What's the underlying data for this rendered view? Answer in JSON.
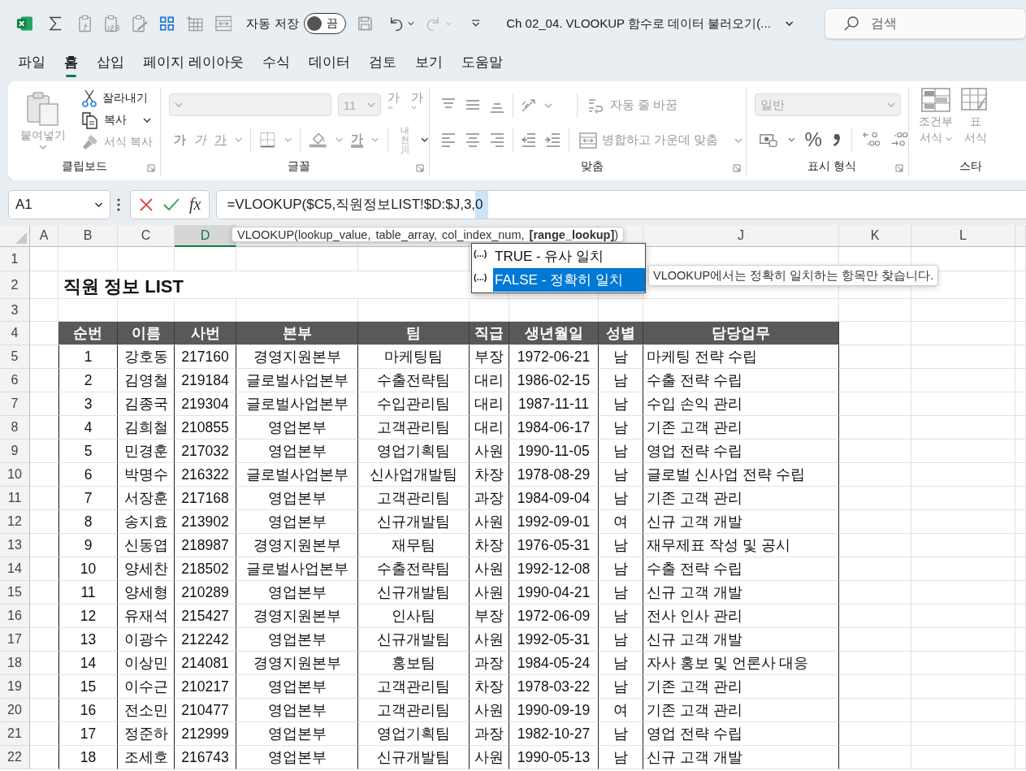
{
  "quick_access": {
    "autosave_label": "자동 저장",
    "autosave": {
      "on": false,
      "label": "끔"
    }
  },
  "title": "Ch 02_04. VLOOKUP 함수로 데이터 불러오기(...",
  "search": {
    "placeholder": "검색"
  },
  "tabs": [
    {
      "label": "파일",
      "selected": false
    },
    {
      "label": "홈",
      "selected": true
    },
    {
      "label": "삽입",
      "selected": false
    },
    {
      "label": "페이지 레이아웃",
      "selected": false
    },
    {
      "label": "수식",
      "selected": false
    },
    {
      "label": "데이터",
      "selected": false
    },
    {
      "label": "검토",
      "selected": false
    },
    {
      "label": "보기",
      "selected": false
    },
    {
      "label": "도움말",
      "selected": false
    }
  ],
  "ribbon": {
    "clipboard": {
      "label": "클립보드",
      "paste": {
        "label": "붙여넣기",
        "disabled": true
      },
      "cut": {
        "label": "잘라내기",
        "disabled": false
      },
      "copy": {
        "label": "복사",
        "disabled": false
      },
      "format_painter": {
        "label": "서식 복사",
        "disabled": true
      }
    },
    "font": {
      "label": "글꼴",
      "size": "11",
      "grow": "가",
      "shrink": "가",
      "bold": "가",
      "italic": "가",
      "underline": "가",
      "font_color": "가",
      "phonetic": [
        "내천",
        "川"
      ]
    },
    "alignment": {
      "label": "맞춤",
      "wrap": {
        "label": "자동 줄 바꿈",
        "disabled": true
      },
      "merge": {
        "label": "병합하고 가운데 맞춤",
        "disabled": true
      }
    },
    "number": {
      "label": "표시 형식",
      "format": "일반",
      "percent": "%"
    },
    "styles": {
      "label": "스타",
      "conditional": {
        "lines": [
          "조건부",
          "서식"
        ],
        "disabled": true
      },
      "table": {
        "lines": [
          "표",
          "서식"
        ],
        "disabled": true
      }
    }
  },
  "formula_bar": {
    "name_box": "A1",
    "insert_function": "fx",
    "formula": "=VLOOKUP($C5,직원정보LIST!$D:$J,3,",
    "formula_selection": "0"
  },
  "column_headers": [
    {
      "label": "A",
      "selected": false
    },
    {
      "label": "B",
      "selected": false
    },
    {
      "label": "C",
      "selected": false
    },
    {
      "label": "D",
      "selected": true
    },
    {
      "label": "J",
      "selected": false
    },
    {
      "label": "K",
      "selected": false
    },
    {
      "label": "L",
      "selected": false
    }
  ],
  "row_numbers": [
    "1",
    "2",
    "3",
    "4",
    "5",
    "6",
    "7",
    "8",
    "9",
    "10",
    "11",
    "12",
    "13",
    "14",
    "15",
    "16",
    "17",
    "18",
    "19",
    "20",
    "21",
    "22"
  ],
  "sheet_title": "직원 정보 LIST",
  "table": {
    "columns": [
      "순번",
      "이름",
      "사번",
      "본부",
      "팀",
      "직급",
      "생년월일",
      "성별",
      "담당업무"
    ],
    "rows": [
      [
        "1",
        "강호동",
        "217160",
        "경영지원본부",
        "마케팅팀",
        "부장",
        "1972-06-21",
        "남",
        "마케팅 전략 수립"
      ],
      [
        "2",
        "김영철",
        "219184",
        "글로벌사업본부",
        "수출전략팀",
        "대리",
        "1986-02-15",
        "남",
        "수출 전략 수립"
      ],
      [
        "3",
        "김종국",
        "219304",
        "글로벌사업본부",
        "수입관리팀",
        "대리",
        "1987-11-11",
        "남",
        "수입 손익 관리"
      ],
      [
        "4",
        "김희철",
        "210855",
        "영업본부",
        "고객관리팀",
        "대리",
        "1984-06-17",
        "남",
        "기존 고객 관리"
      ],
      [
        "5",
        "민경훈",
        "217032",
        "영업본부",
        "영업기획팀",
        "사원",
        "1990-11-05",
        "남",
        "영업 전략 수립"
      ],
      [
        "6",
        "박명수",
        "216322",
        "글로벌사업본부",
        "신사업개발팀",
        "차장",
        "1978-08-29",
        "남",
        "글로벌 신사업 전략 수립"
      ],
      [
        "7",
        "서장훈",
        "217168",
        "영업본부",
        "고객관리팀",
        "과장",
        "1984-09-04",
        "남",
        "기존 고객 관리"
      ],
      [
        "8",
        "송지효",
        "213902",
        "영업본부",
        "신규개발팀",
        "사원",
        "1992-09-01",
        "여",
        "신규 고객 개발"
      ],
      [
        "9",
        "신동엽",
        "218987",
        "경영지원본부",
        "재무팀",
        "차장",
        "1976-05-31",
        "남",
        "재무제표 작성 및 공시"
      ],
      [
        "10",
        "양세찬",
        "218502",
        "글로벌사업본부",
        "수출전략팀",
        "사원",
        "1992-12-08",
        "남",
        "수출 전략 수립"
      ],
      [
        "11",
        "양세형",
        "210289",
        "영업본부",
        "신규개발팀",
        "사원",
        "1990-04-21",
        "남",
        "신규 고객 개발"
      ],
      [
        "12",
        "유재석",
        "215427",
        "경영지원본부",
        "인사팀",
        "부장",
        "1972-06-09",
        "남",
        "전사 인사 관리"
      ],
      [
        "13",
        "이광수",
        "212242",
        "영업본부",
        "신규개발팀",
        "사원",
        "1992-05-31",
        "남",
        "신규 고객 개발"
      ],
      [
        "14",
        "이상민",
        "214081",
        "경영지원본부",
        "홍보팀",
        "과장",
        "1984-05-24",
        "남",
        "자사 홍보 및 언론사 대응"
      ],
      [
        "15",
        "이수근",
        "210217",
        "영업본부",
        "고객관리팀",
        "차장",
        "1978-03-22",
        "남",
        "기존 고객 관리"
      ],
      [
        "16",
        "전소민",
        "210477",
        "영업본부",
        "고객관리팀",
        "사원",
        "1990-09-19",
        "여",
        "기존 고객 관리"
      ],
      [
        "17",
        "정준하",
        "212999",
        "영업본부",
        "영업기획팀",
        "과장",
        "1982-10-27",
        "남",
        "영업 전략 수립"
      ],
      [
        "18",
        "조세호",
        "216743",
        "영업본부",
        "신규개발팀",
        "사원",
        "1990-05-13",
        "남",
        "신규 고객 개발"
      ]
    ]
  },
  "tooltip": "VLOOKUP(lookup_value, table_array, col_index_num, **[range_lookup]**)",
  "autocomplete": {
    "items": [
      {
        "marker": "(...)",
        "label": "TRUE - 유사 일치",
        "selected": false
      },
      {
        "marker": "(...)",
        "label": "FALSE - 정확히 일치",
        "selected": true
      }
    ],
    "hint": "VLOOKUP에서는 정확히 일치하는 항목만 찾습니다."
  }
}
